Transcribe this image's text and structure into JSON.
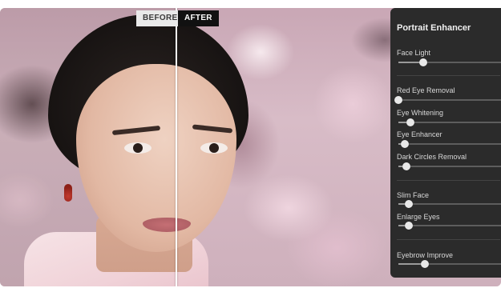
{
  "compare": {
    "before_label": "BEFORE",
    "after_label": "AFTER"
  },
  "panel": {
    "title": "Portrait Enhancer",
    "controls": [
      {
        "label": "Face Light",
        "value": 0.24
      },
      {
        "label": "Red Eye Removal",
        "value": 0.0
      },
      {
        "label": "Eye Whitening",
        "value": 0.12
      },
      {
        "label": "Eye Enhancer",
        "value": 0.06
      },
      {
        "label": "Dark Circles Removal",
        "value": 0.08
      },
      {
        "label": "Slim Face",
        "value": 0.1
      },
      {
        "label": "Enlarge Eyes",
        "value": 0.1
      },
      {
        "label": "Eyebrow Improve",
        "value": 0.26
      }
    ]
  },
  "photo": {
    "subject": "portrait-woman-cherry-blossom"
  }
}
